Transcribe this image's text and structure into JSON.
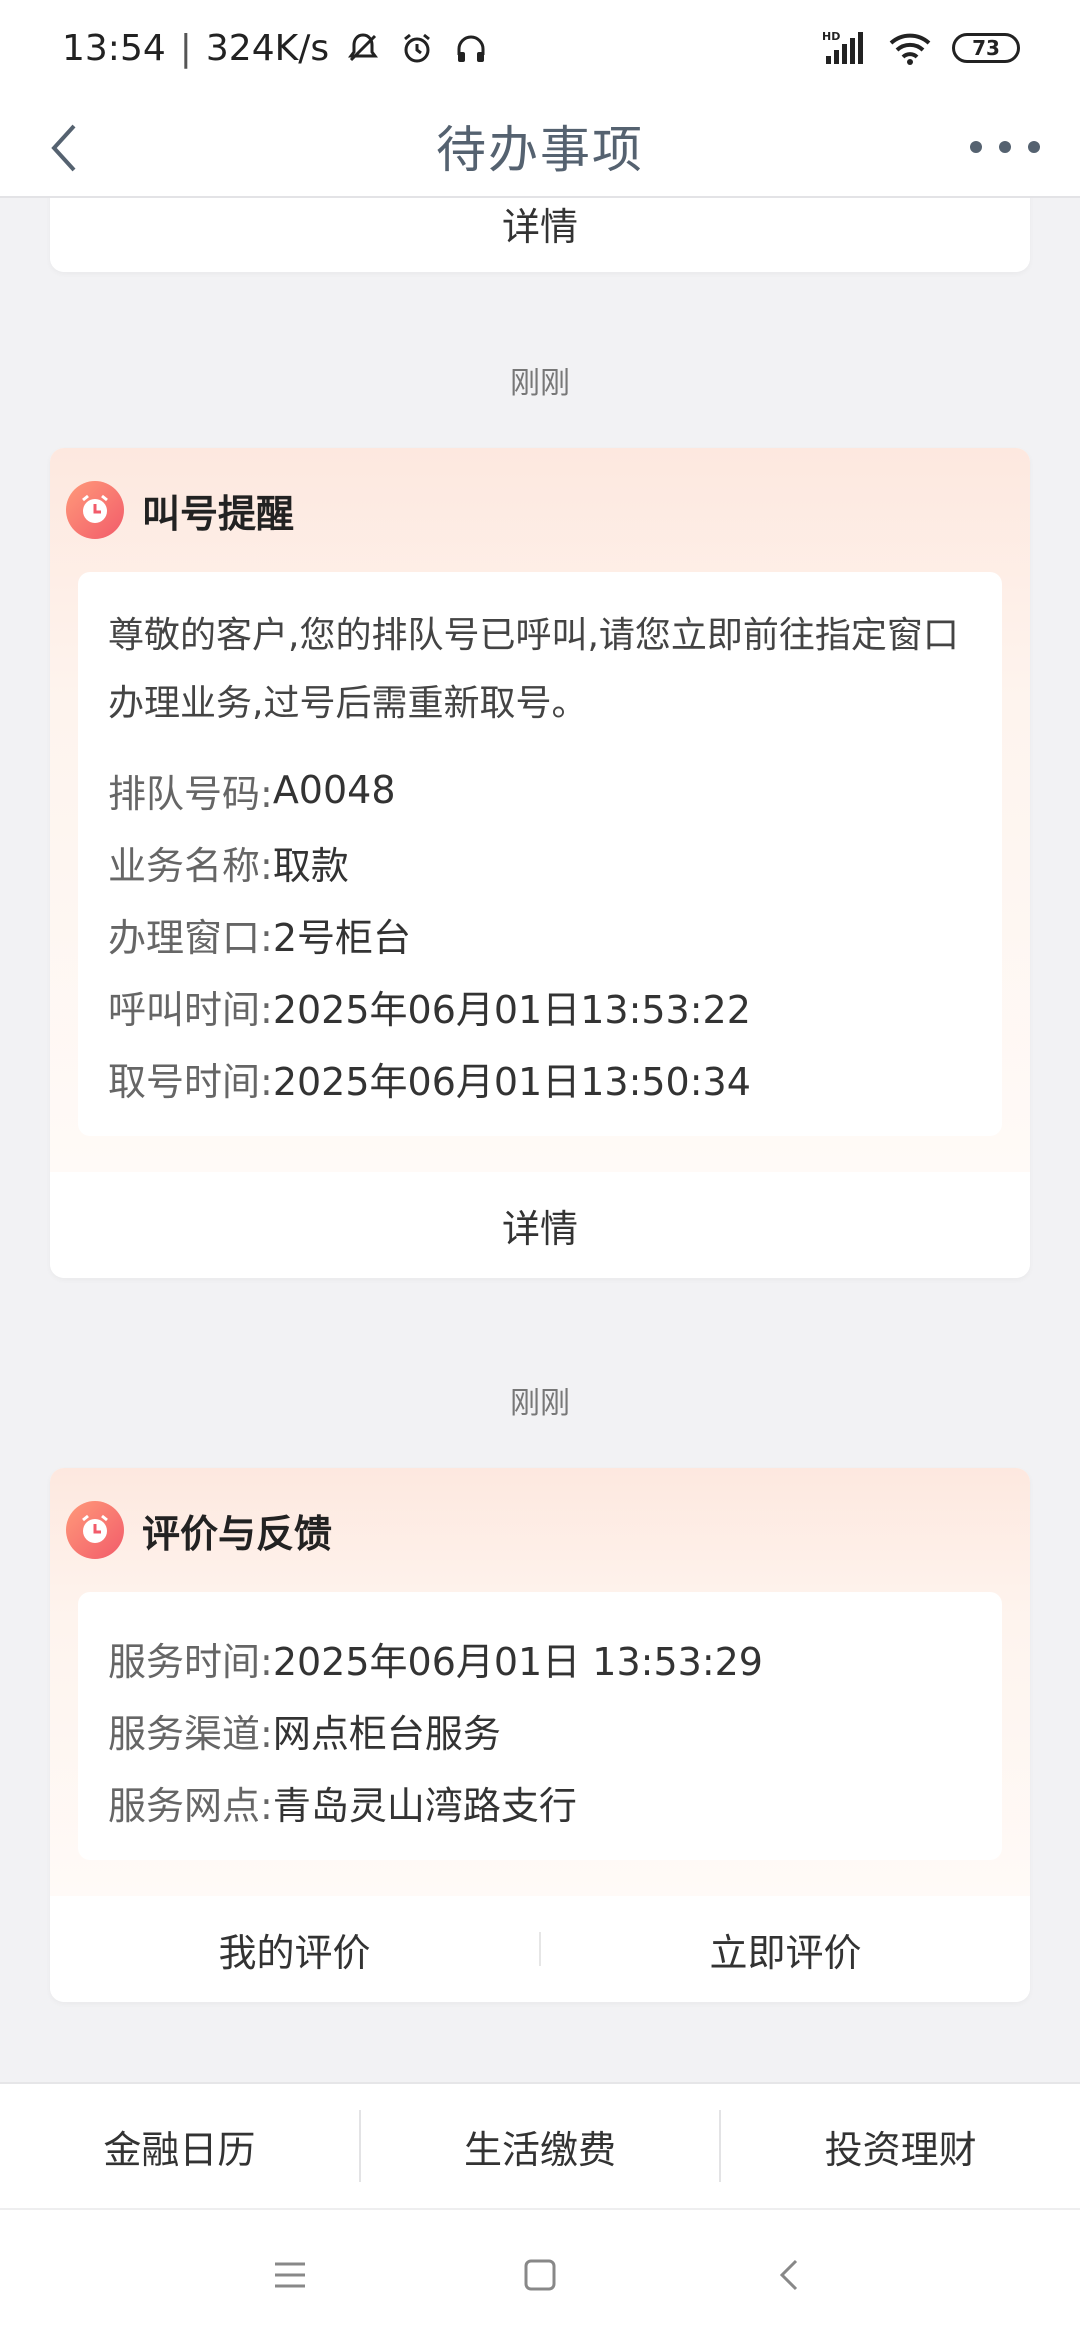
{
  "status_bar": {
    "time": "13:54",
    "separator": "|",
    "speed": "324K/s",
    "network": "HD",
    "battery": "73"
  },
  "nav": {
    "title": "待办事项"
  },
  "top_card": {
    "detail_label": "详情"
  },
  "card1": {
    "time_label": "刚刚",
    "title": "叫号提醒",
    "notice": "尊敬的客户,您的排队号已呼叫,请您立即前往指定窗口办理业务,过号后需重新取号。",
    "fields": [
      {
        "key": "排队号码:",
        "value": "A0048"
      },
      {
        "key": "业务名称:",
        "value": "取款"
      },
      {
        "key": "办理窗口:",
        "value": "2号柜台"
      },
      {
        "key": "呼叫时间:",
        "value": "2025年06月01日13:53:22"
      },
      {
        "key": "取号时间:",
        "value": "2025年06月01日13:50:34"
      }
    ],
    "detail_label": "详情"
  },
  "card2": {
    "time_label": "刚刚",
    "title": "评价与反馈",
    "fields": [
      {
        "key": "服务时间:",
        "value": "2025年06月01日 13:53:29"
      },
      {
        "key": "服务渠道:",
        "value": "网点柜台服务"
      },
      {
        "key": "服务网点:",
        "value": "青岛灵山湾路支行"
      }
    ],
    "my_review_label": "我的评价",
    "review_now_label": "立即评价"
  },
  "bottom_tabs": [
    {
      "label": "金融日历"
    },
    {
      "label": "生活缴费"
    },
    {
      "label": "投资理财"
    }
  ]
}
